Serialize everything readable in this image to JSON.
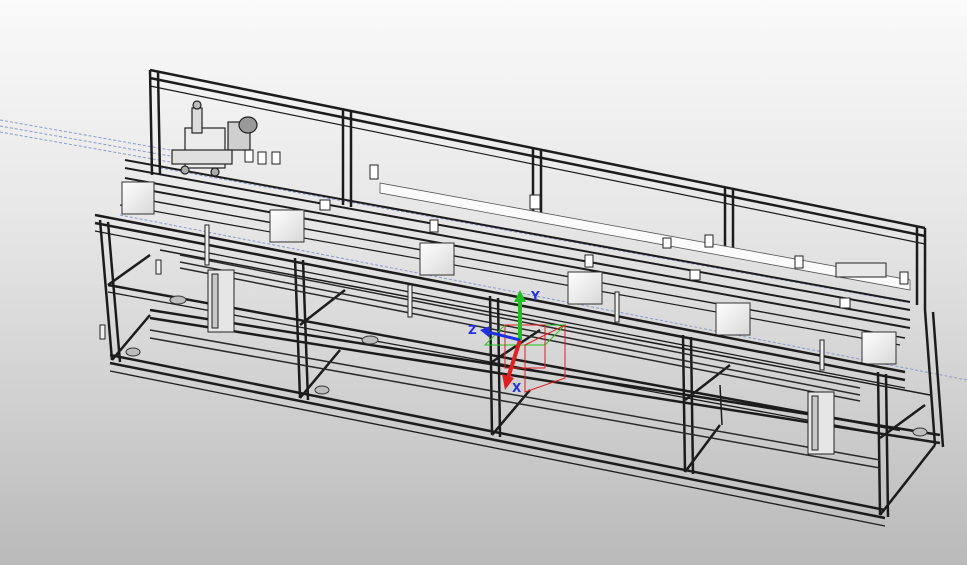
{
  "viewport": {
    "background_top": "#fafafa",
    "background_bottom": "#b9b9b9"
  },
  "model": {
    "type": "aluminum-extrusion-frame-conveyor-assembly",
    "frame_color": "#1c1c1c",
    "panel_color": "#f2f2f2",
    "guide_line_color": "#8a9bc8"
  },
  "triad": {
    "x_color": "#e02020",
    "y_color": "#20c020",
    "z_color": "#2030e0",
    "z_label": "Z",
    "y_label": "Y",
    "x_label": "X"
  }
}
